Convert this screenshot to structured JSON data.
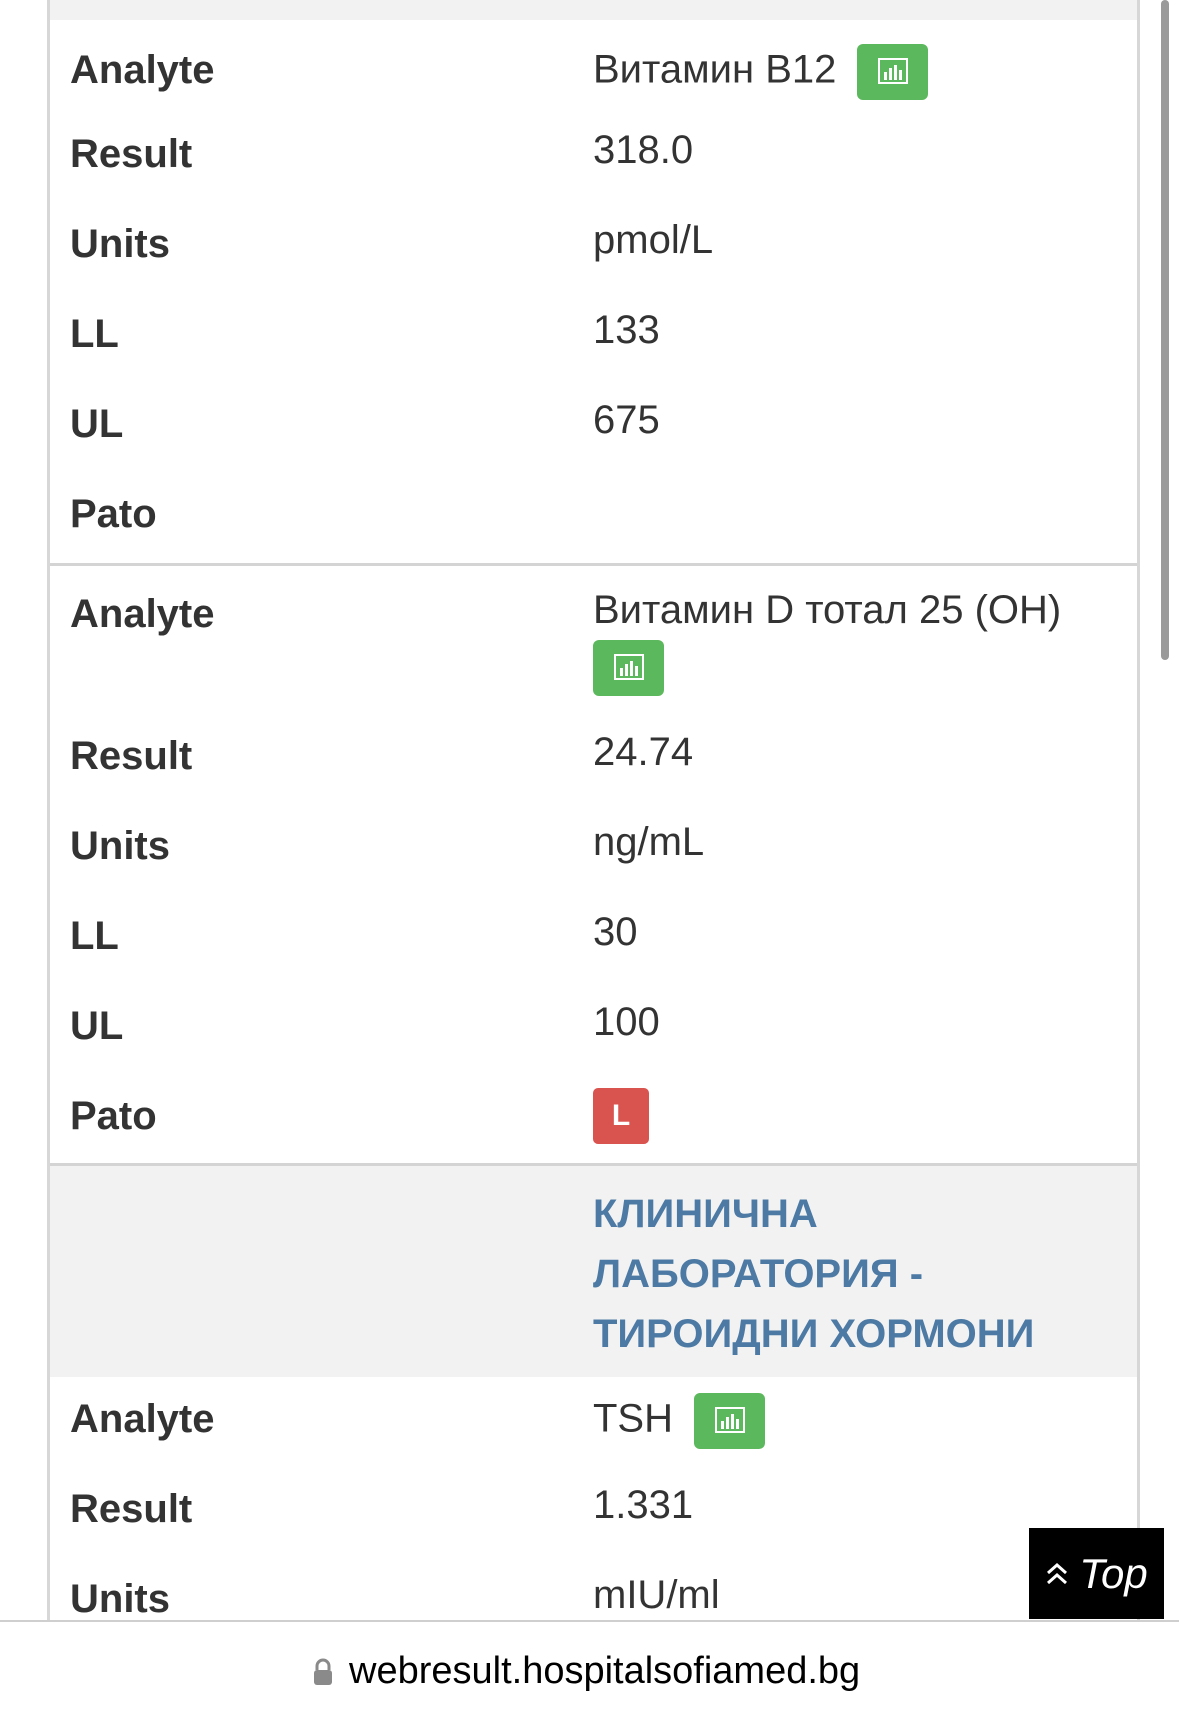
{
  "labels": {
    "analyte": "Analyte",
    "result": "Result",
    "units": "Units",
    "ll": "LL",
    "ul": "UL",
    "pato": "Pato"
  },
  "records": [
    {
      "analyte": "Витамин B12",
      "result": "318.0",
      "units": "pmol/L",
      "ll": "133",
      "ul": "675",
      "pato": ""
    },
    {
      "analyte": "Витамин D тотал 25 (OH)",
      "result": "24.74",
      "units": "ng/mL",
      "ll": "30",
      "ul": "100",
      "pato": "L"
    },
    {
      "analyte": "TSH",
      "result": "1.331",
      "units": "mIU/ml"
    }
  ],
  "section_title": "КЛИНИЧНА ЛАБОРАТОРИЯ - ТИРОИДНИ ХОРМОНИ",
  "top_button": {
    "label": "Top",
    "icon": "double-chevron-up-icon"
  },
  "address_bar": {
    "url": "webresult.hospitalsofiamed.bg",
    "icon": "lock-icon"
  },
  "colors": {
    "chart_button": "#5cb85c",
    "pato_badge": "#d9534f",
    "section_title": "#4c7aa4"
  }
}
